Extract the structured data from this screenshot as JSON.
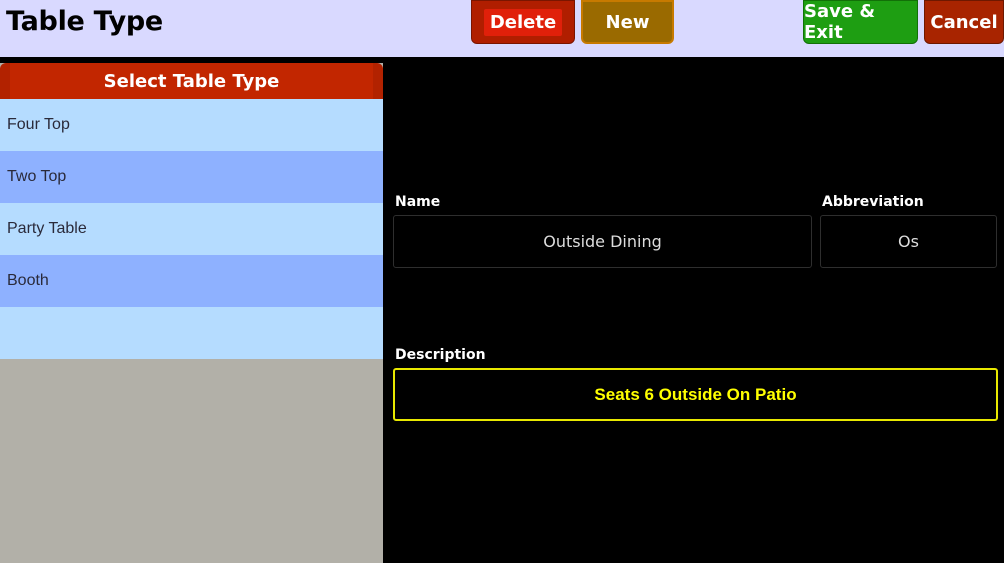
{
  "header": {
    "title": "Table Type",
    "delete_label": "Delete",
    "new_label": "New",
    "save_exit_label": "Save & Exit",
    "cancel_label": "Cancel"
  },
  "table_types": {
    "heading": "Select Table Type",
    "items": [
      {
        "label": "Four Top"
      },
      {
        "label": "Two Top"
      },
      {
        "label": "Party Table"
      },
      {
        "label": "Booth"
      },
      {
        "label": ""
      }
    ]
  },
  "form": {
    "name_label": "Name",
    "name_value": "Outside Dining",
    "abbreviation_label": "Abbreviation",
    "abbreviation_value": "Os",
    "description_label": "Description",
    "description_value": "Seats 6 Outside On Patio"
  },
  "colors": {
    "header_bg": "#d9d9ff",
    "delete": "#e0200a",
    "new": "#9a6a00",
    "save": "#1e9e12",
    "cancel": "#a82400",
    "list_light": "#b5dcff",
    "list_dark": "#8eb1ff",
    "active_field": "#ffff00"
  }
}
